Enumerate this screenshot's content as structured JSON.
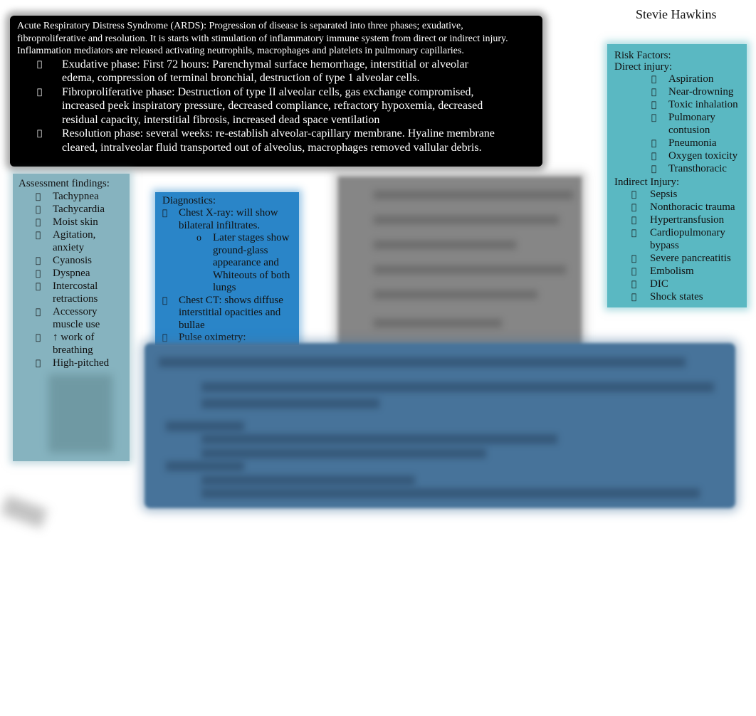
{
  "author": "Stevie Hawkins",
  "bullet_glyph": "",
  "sub_bullet_glyph": "o",
  "intro": {
    "paragraph": "Acute Respiratory Distress Syndrome (ARDS):      Progression of disease is separated into three phases; exudative, fibroproliferative and resolution. It is starts with stimulation of inflammatory immune system from direct or indirect injury. Inflammation mediators are released activating neutrophils, macrophages and platelets in pulmonary capillaries.",
    "phases": [
      "Exudative phase: First 72 hours: Parenchymal surface hemorrhage, interstitial or alveolar edema, compression of terminal bronchial, destruction of type 1 alveolar cells.",
      "Fibroproliferative phase:     Destruction of type II alveolar cells, gas exchange compromised, increased peek inspiratory pressure, decreased compliance, refractory hypoxemia, decreased residual capacity, interstitial fibrosis, increased dead space ventilation",
      "Resolution phase:   several weeks: re-establish alveolar-capillary membrane. Hyaline membrane cleared, intralveolar fluid transported out of alveolus, macrophages removed vallular debris."
    ]
  },
  "risk_factors": {
    "title": "Risk Factors:",
    "direct_label": "Direct injury:",
    "direct": [
      "Aspiration",
      "Near-drowning",
      "Toxic inhalation",
      "Pulmonary contusion",
      "Pneumonia",
      "Oxygen toxicity",
      "Transthoracic"
    ],
    "indirect_label": "Indirect  Injury:",
    "indirect": [
      "Sepsis",
      "Nonthoracic trauma",
      "Hypertransfusion",
      "Cardiopulmonary bypass",
      "Severe pancreatitis",
      "Embolism",
      "DIC",
      "Shock states"
    ]
  },
  "assessment": {
    "title": "Assessment findings:",
    "items": [
      "Tachypnea",
      "Tachycardia",
      "Moist skin",
      "Agitation, anxiety",
      "Cyanosis",
      "Dyspnea",
      "Intercostal retractions",
      "Accessory muscle use",
      "↑ work of breathing",
      "High-pitched"
    ]
  },
  "diagnostics": {
    "title": "Diagnostics:",
    "items": [
      {
        "text": "Chest X-ray: will show bilateral infiltrates.",
        "sub": [
          "Later stages show ground-glass appearance and Whiteouts of both lungs"
        ]
      },
      {
        "text": "Chest CT: shows diffuse interstitial opacities and bullae",
        "sub": []
      },
      {
        "text": "Pulse oximetry:",
        "sub": []
      }
    ]
  }
}
